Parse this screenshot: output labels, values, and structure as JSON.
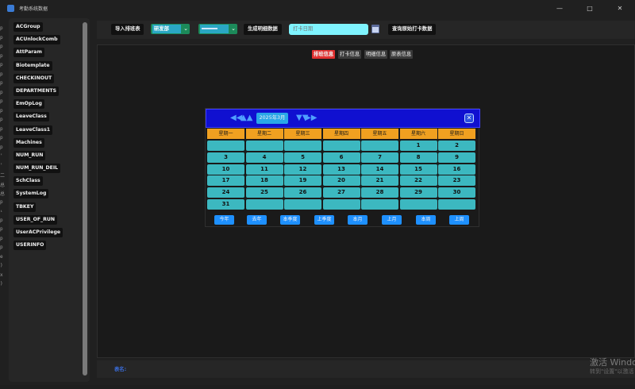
{
  "window": {
    "title": "考勤系统数据",
    "controls": [
      "—",
      "□",
      "✕"
    ]
  },
  "edge_chars": [
    "p",
    "p",
    "p",
    "p",
    "p",
    "p",
    "p",
    "p",
    "p",
    "p",
    "p",
    "p",
    "p",
    "p",
    "'",
    "'",
    "二",
    "总",
    "总",
    "p",
    "ᵢ",
    "p",
    "p",
    "p",
    "p",
    "e",
    ")",
    "x",
    ")"
  ],
  "sidebar": {
    "tables": [
      "ACGroup",
      "ACUnlockComb",
      "AttParam",
      "Biotemplate",
      "CHECKINOUT",
      "DEPARTMENTS",
      "EmOpLog",
      "LeaveClass",
      "LeaveClass1",
      "Machines",
      "NUM_RUN",
      "NUM_RUN_DEIL",
      "SchClass",
      "SystemLog",
      "TBKEY",
      "USER_OF_RUN",
      "UserACPrivilege",
      "USERINFO"
    ]
  },
  "toolbar": {
    "import_schedule": "导入排班表",
    "department_select": "研发部",
    "employee_select": "",
    "generate_detail": "生成明细数据",
    "date_placeholder": "打卡日期",
    "query_raw": "查询原始打卡数据"
  },
  "tabs": [
    {
      "label": "排班信息",
      "active": true
    },
    {
      "label": "打卡信息",
      "active": false
    },
    {
      "label": "明细信息",
      "active": false
    },
    {
      "label": "原表信息",
      "active": false
    }
  ],
  "calendar": {
    "month_label": "2025年3月",
    "prev_year": "◀◀",
    "prev_month": "▲▲",
    "next_month": "▼▼",
    "next_year": "▶▶",
    "close": "✕",
    "weekdays": [
      "星期一",
      "星期二",
      "星期三",
      "星期四",
      "星期五",
      "星期六",
      "星期日"
    ],
    "days": [
      [
        "",
        "",
        "",
        "",
        "",
        "1",
        "2"
      ],
      [
        "3",
        "4",
        "5",
        "6",
        "7",
        "8",
        "9"
      ],
      [
        "10",
        "11",
        "12",
        "13",
        "14",
        "15",
        "16"
      ],
      [
        "17",
        "18",
        "19",
        "20",
        "21",
        "22",
        "23"
      ],
      [
        "24",
        "25",
        "26",
        "27",
        "28",
        "29",
        "30"
      ],
      [
        "31",
        "",
        "",
        "",
        "",
        "",
        ""
      ]
    ],
    "quick_buttons": [
      "今年",
      "去年",
      "本季度",
      "上季度",
      "本月",
      "上月",
      "本周",
      "上周"
    ]
  },
  "status": {
    "table_name_label": "表名:"
  },
  "activation": {
    "line1": "激活 Window",
    "line2": "转到\"设置\"以激活"
  }
}
